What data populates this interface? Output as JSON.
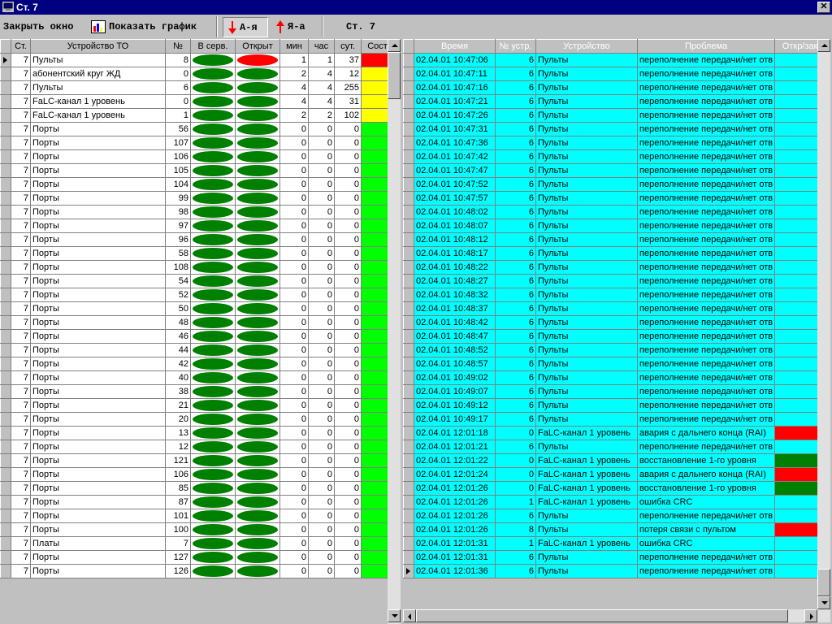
{
  "window": {
    "title": "Ст. 7",
    "close_label": "✕"
  },
  "toolbar": {
    "close_window": "Закрыть окно",
    "show_chart": "Показать график",
    "sort_asc": "А-я",
    "sort_desc": "Я-а",
    "station": "Ст. 7"
  },
  "colors": {
    "green": "#008000",
    "red": "#ff0000",
    "yellow": "#ffff00",
    "lime": "#00ff00",
    "cyan": "#00ffff",
    "header_olive": "#808000"
  },
  "left_table": {
    "columns": [
      "Ст.",
      "Устройство ТО",
      "№",
      "В серв.",
      "Открыт",
      "мин",
      "час",
      "сут.",
      "Сост"
    ],
    "rows": [
      {
        "st": "7",
        "dev": "Пульты",
        "num": "8",
        "serv": "green",
        "open": "red",
        "min": "1",
        "hour": "1",
        "day": "37",
        "state": "#ff0000"
      },
      {
        "st": "7",
        "dev": "абонентский круг ЖД",
        "num": "0",
        "serv": "green",
        "open": "green",
        "min": "2",
        "hour": "4",
        "day": "12",
        "state": "#ffff00"
      },
      {
        "st": "7",
        "dev": "Пульты",
        "num": "6",
        "serv": "green",
        "open": "green",
        "min": "4",
        "hour": "4",
        "day": "255",
        "state": "#ffff00"
      },
      {
        "st": "7",
        "dev": "FaLC-канал 1 уровень",
        "num": "0",
        "serv": "green",
        "open": "green",
        "min": "4",
        "hour": "4",
        "day": "31",
        "state": "#ffff00"
      },
      {
        "st": "7",
        "dev": "FaLC-канал 1 уровень",
        "num": "1",
        "serv": "green",
        "open": "green",
        "min": "2",
        "hour": "2",
        "day": "102",
        "state": "#ffff00"
      },
      {
        "st": "7",
        "dev": "Порты",
        "num": "56",
        "serv": "green",
        "open": "green",
        "min": "0",
        "hour": "0",
        "day": "0",
        "state": "#00ff00"
      },
      {
        "st": "7",
        "dev": "Порты",
        "num": "107",
        "serv": "green",
        "open": "green",
        "min": "0",
        "hour": "0",
        "day": "0",
        "state": "#00ff00"
      },
      {
        "st": "7",
        "dev": "Порты",
        "num": "106",
        "serv": "green",
        "open": "green",
        "min": "0",
        "hour": "0",
        "day": "0",
        "state": "#00ff00"
      },
      {
        "st": "7",
        "dev": "Порты",
        "num": "105",
        "serv": "green",
        "open": "green",
        "min": "0",
        "hour": "0",
        "day": "0",
        "state": "#00ff00"
      },
      {
        "st": "7",
        "dev": "Порты",
        "num": "104",
        "serv": "green",
        "open": "green",
        "min": "0",
        "hour": "0",
        "day": "0",
        "state": "#00ff00"
      },
      {
        "st": "7",
        "dev": "Порты",
        "num": "99",
        "serv": "green",
        "open": "green",
        "min": "0",
        "hour": "0",
        "day": "0",
        "state": "#00ff00"
      },
      {
        "st": "7",
        "dev": "Порты",
        "num": "98",
        "serv": "green",
        "open": "green",
        "min": "0",
        "hour": "0",
        "day": "0",
        "state": "#00ff00"
      },
      {
        "st": "7",
        "dev": "Порты",
        "num": "97",
        "serv": "green",
        "open": "green",
        "min": "0",
        "hour": "0",
        "day": "0",
        "state": "#00ff00"
      },
      {
        "st": "7",
        "dev": "Порты",
        "num": "96",
        "serv": "green",
        "open": "green",
        "min": "0",
        "hour": "0",
        "day": "0",
        "state": "#00ff00"
      },
      {
        "st": "7",
        "dev": "Порты",
        "num": "58",
        "serv": "green",
        "open": "green",
        "min": "0",
        "hour": "0",
        "day": "0",
        "state": "#00ff00"
      },
      {
        "st": "7",
        "dev": "Порты",
        "num": "108",
        "serv": "green",
        "open": "green",
        "min": "0",
        "hour": "0",
        "day": "0",
        "state": "#00ff00"
      },
      {
        "st": "7",
        "dev": "Порты",
        "num": "54",
        "serv": "green",
        "open": "green",
        "min": "0",
        "hour": "0",
        "day": "0",
        "state": "#00ff00"
      },
      {
        "st": "7",
        "dev": "Порты",
        "num": "52",
        "serv": "green",
        "open": "green",
        "min": "0",
        "hour": "0",
        "day": "0",
        "state": "#00ff00"
      },
      {
        "st": "7",
        "dev": "Порты",
        "num": "50",
        "serv": "green",
        "open": "green",
        "min": "0",
        "hour": "0",
        "day": "0",
        "state": "#00ff00"
      },
      {
        "st": "7",
        "dev": "Порты",
        "num": "48",
        "serv": "green",
        "open": "green",
        "min": "0",
        "hour": "0",
        "day": "0",
        "state": "#00ff00"
      },
      {
        "st": "7",
        "dev": "Порты",
        "num": "46",
        "serv": "green",
        "open": "green",
        "min": "0",
        "hour": "0",
        "day": "0",
        "state": "#00ff00"
      },
      {
        "st": "7",
        "dev": "Порты",
        "num": "44",
        "serv": "green",
        "open": "green",
        "min": "0",
        "hour": "0",
        "day": "0",
        "state": "#00ff00"
      },
      {
        "st": "7",
        "dev": "Порты",
        "num": "42",
        "serv": "green",
        "open": "green",
        "min": "0",
        "hour": "0",
        "day": "0",
        "state": "#00ff00"
      },
      {
        "st": "7",
        "dev": "Порты",
        "num": "40",
        "serv": "green",
        "open": "green",
        "min": "0",
        "hour": "0",
        "day": "0",
        "state": "#00ff00"
      },
      {
        "st": "7",
        "dev": "Порты",
        "num": "38",
        "serv": "green",
        "open": "green",
        "min": "0",
        "hour": "0",
        "day": "0",
        "state": "#00ff00"
      },
      {
        "st": "7",
        "dev": "Порты",
        "num": "21",
        "serv": "green",
        "open": "green",
        "min": "0",
        "hour": "0",
        "day": "0",
        "state": "#00ff00"
      },
      {
        "st": "7",
        "dev": "Порты",
        "num": "20",
        "serv": "green",
        "open": "green",
        "min": "0",
        "hour": "0",
        "day": "0",
        "state": "#00ff00"
      },
      {
        "st": "7",
        "dev": "Порты",
        "num": "13",
        "serv": "green",
        "open": "green",
        "min": "0",
        "hour": "0",
        "day": "0",
        "state": "#00ff00"
      },
      {
        "st": "7",
        "dev": "Порты",
        "num": "12",
        "serv": "green",
        "open": "green",
        "min": "0",
        "hour": "0",
        "day": "0",
        "state": "#00ff00"
      },
      {
        "st": "7",
        "dev": "Порты",
        "num": "121",
        "serv": "green",
        "open": "green",
        "min": "0",
        "hour": "0",
        "day": "0",
        "state": "#00ff00"
      },
      {
        "st": "7",
        "dev": "Порты",
        "num": "106",
        "serv": "green",
        "open": "green",
        "min": "0",
        "hour": "0",
        "day": "0",
        "state": "#00ff00"
      },
      {
        "st": "7",
        "dev": "Порты",
        "num": "85",
        "serv": "green",
        "open": "green",
        "min": "0",
        "hour": "0",
        "day": "0",
        "state": "#00ff00"
      },
      {
        "st": "7",
        "dev": "Порты",
        "num": "87",
        "serv": "green",
        "open": "green",
        "min": "0",
        "hour": "0",
        "day": "0",
        "state": "#00ff00"
      },
      {
        "st": "7",
        "dev": "Порты",
        "num": "101",
        "serv": "green",
        "open": "green",
        "min": "0",
        "hour": "0",
        "day": "0",
        "state": "#00ff00"
      },
      {
        "st": "7",
        "dev": "Порты",
        "num": "100",
        "serv": "green",
        "open": "green",
        "min": "0",
        "hour": "0",
        "day": "0",
        "state": "#00ff00"
      },
      {
        "st": "7",
        "dev": "Платы",
        "num": "7",
        "serv": "green",
        "open": "green",
        "min": "0",
        "hour": "0",
        "day": "0",
        "state": "#00ff00"
      },
      {
        "st": "7",
        "dev": "Порты",
        "num": "127",
        "serv": "green",
        "open": "green",
        "min": "0",
        "hour": "0",
        "day": "0",
        "state": "#00ff00"
      },
      {
        "st": "7",
        "dev": "Порты",
        "num": "126",
        "serv": "green",
        "open": "green",
        "min": "0",
        "hour": "0",
        "day": "0",
        "state": "#00ff00"
      }
    ]
  },
  "right_table": {
    "columns": [
      "Время",
      "№ устр.",
      "Устройство",
      "Проблема",
      "Откр/закр"
    ],
    "rows": [
      {
        "time": "02.04.01 10:47:06",
        "num": "6",
        "dev": "Пульты",
        "prob": "переполнение передачи/нет отв",
        "oc": ""
      },
      {
        "time": "02.04.01 10:47:11",
        "num": "6",
        "dev": "Пульты",
        "prob": "переполнение передачи/нет отв",
        "oc": ""
      },
      {
        "time": "02.04.01 10:47:16",
        "num": "6",
        "dev": "Пульты",
        "prob": "переполнение передачи/нет отв",
        "oc": ""
      },
      {
        "time": "02.04.01 10:47:21",
        "num": "6",
        "dev": "Пульты",
        "prob": "переполнение передачи/нет отв",
        "oc": ""
      },
      {
        "time": "02.04.01 10:47:26",
        "num": "6",
        "dev": "Пульты",
        "prob": "переполнение передачи/нет отв",
        "oc": ""
      },
      {
        "time": "02.04.01 10:47:31",
        "num": "6",
        "dev": "Пульты",
        "prob": "переполнение передачи/нет отв",
        "oc": ""
      },
      {
        "time": "02.04.01 10:47:36",
        "num": "6",
        "dev": "Пульты",
        "prob": "переполнение передачи/нет отв",
        "oc": ""
      },
      {
        "time": "02.04.01 10:47:42",
        "num": "6",
        "dev": "Пульты",
        "prob": "переполнение передачи/нет отв",
        "oc": ""
      },
      {
        "time": "02.04.01 10:47:47",
        "num": "6",
        "dev": "Пульты",
        "prob": "переполнение передачи/нет отв",
        "oc": ""
      },
      {
        "time": "02.04.01 10:47:52",
        "num": "6",
        "dev": "Пульты",
        "prob": "переполнение передачи/нет отв",
        "oc": ""
      },
      {
        "time": "02.04.01 10:47:57",
        "num": "6",
        "dev": "Пульты",
        "prob": "переполнение передачи/нет отв",
        "oc": ""
      },
      {
        "time": "02.04.01 10:48:02",
        "num": "6",
        "dev": "Пульты",
        "prob": "переполнение передачи/нет отв",
        "oc": ""
      },
      {
        "time": "02.04.01 10:48:07",
        "num": "6",
        "dev": "Пульты",
        "prob": "переполнение передачи/нет отв",
        "oc": ""
      },
      {
        "time": "02.04.01 10:48:12",
        "num": "6",
        "dev": "Пульты",
        "prob": "переполнение передачи/нет отв",
        "oc": ""
      },
      {
        "time": "02.04.01 10:48:17",
        "num": "6",
        "dev": "Пульты",
        "prob": "переполнение передачи/нет отв",
        "oc": ""
      },
      {
        "time": "02.04.01 10:48:22",
        "num": "6",
        "dev": "Пульты",
        "prob": "переполнение передачи/нет отв",
        "oc": ""
      },
      {
        "time": "02.04.01 10:48:27",
        "num": "6",
        "dev": "Пульты",
        "prob": "переполнение передачи/нет отв",
        "oc": ""
      },
      {
        "time": "02.04.01 10:48:32",
        "num": "6",
        "dev": "Пульты",
        "prob": "переполнение передачи/нет отв",
        "oc": ""
      },
      {
        "time": "02.04.01 10:48:37",
        "num": "6",
        "dev": "Пульты",
        "prob": "переполнение передачи/нет отв",
        "oc": ""
      },
      {
        "time": "02.04.01 10:48:42",
        "num": "6",
        "dev": "Пульты",
        "prob": "переполнение передачи/нет отв",
        "oc": ""
      },
      {
        "time": "02.04.01 10:48:47",
        "num": "6",
        "dev": "Пульты",
        "prob": "переполнение передачи/нет отв",
        "oc": ""
      },
      {
        "time": "02.04.01 10:48:52",
        "num": "6",
        "dev": "Пульты",
        "prob": "переполнение передачи/нет отв",
        "oc": ""
      },
      {
        "time": "02.04.01 10:48:57",
        "num": "6",
        "dev": "Пульты",
        "prob": "переполнение передачи/нет отв",
        "oc": ""
      },
      {
        "time": "02.04.01 10:49:02",
        "num": "6",
        "dev": "Пульты",
        "prob": "переполнение передачи/нет отв",
        "oc": ""
      },
      {
        "time": "02.04.01 10:49:07",
        "num": "6",
        "dev": "Пульты",
        "prob": "переполнение передачи/нет отв",
        "oc": ""
      },
      {
        "time": "02.04.01 10:49:12",
        "num": "6",
        "dev": "Пульты",
        "prob": "переполнение передачи/нет отв",
        "oc": ""
      },
      {
        "time": "02.04.01 10:49:17",
        "num": "6",
        "dev": "Пульты",
        "prob": "переполнение передачи/нет отв",
        "oc": ""
      },
      {
        "time": "02.04.01 12:01:18",
        "num": "0",
        "dev": "FaLC-канал 1 уровень",
        "prob": "авария с дальнего конца (RAI)",
        "oc": "#ff0000"
      },
      {
        "time": "02.04.01 12:01:21",
        "num": "6",
        "dev": "Пульты",
        "prob": "переполнение передачи/нет отв",
        "oc": ""
      },
      {
        "time": "02.04.01 12:01:22",
        "num": "0",
        "dev": "FaLC-канал 1 уровень",
        "prob": "восстановление 1-го уровня",
        "oc": "#008000"
      },
      {
        "time": "02.04.01 12:01:24",
        "num": "0",
        "dev": "FaLC-канал 1 уровень",
        "prob": "авария с дальнего конца (RAI)",
        "oc": "#ff0000"
      },
      {
        "time": "02.04.01 12:01:26",
        "num": "0",
        "dev": "FaLC-канал 1 уровень",
        "prob": "восстановление 1-го уровня",
        "oc": "#008000"
      },
      {
        "time": "02.04.01 12:01:26",
        "num": "1",
        "dev": "FaLC-канал 1 уровень",
        "prob": "ошибка CRC",
        "oc": ""
      },
      {
        "time": "02.04.01 12:01:26",
        "num": "6",
        "dev": "Пульты",
        "prob": "переполнение передачи/нет отв",
        "oc": ""
      },
      {
        "time": "02.04.01 12:01:26",
        "num": "8",
        "dev": "Пульты",
        "prob": "потеря связи с пультом",
        "oc": "#ff0000"
      },
      {
        "time": "02.04.01 12:01:31",
        "num": "1",
        "dev": "FaLC-канал 1 уровень",
        "prob": "ошибка CRC",
        "oc": ""
      },
      {
        "time": "02.04.01 12:01:31",
        "num": "6",
        "dev": "Пульты",
        "prob": "переполнение передачи/нет отв",
        "oc": ""
      },
      {
        "time": "02.04.01 12:01:36",
        "num": "6",
        "dev": "Пульты",
        "prob": "переполнение передачи/нет отв",
        "oc": ""
      }
    ]
  }
}
